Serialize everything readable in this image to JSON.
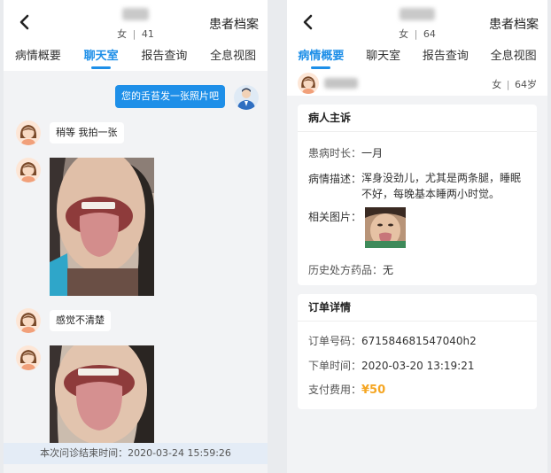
{
  "left": {
    "header": {
      "gender": "女",
      "age": "41",
      "archive_label": "患者档案"
    },
    "tabs": [
      "病情概要",
      "聊天室",
      "报告查询",
      "全息视图"
    ],
    "active_tab": 1,
    "messages": {
      "doctor_msg": "您的舌苔发一张照片吧",
      "patient_msg1": "稍等 我拍一张",
      "patient_msg2": "感觉不清楚"
    },
    "end_notice": "本次问诊结束时间：2020-03-24 15:59:26"
  },
  "right": {
    "header": {
      "gender": "女",
      "age": "64",
      "archive_label": "患者档案"
    },
    "tabs": [
      "病情概要",
      "聊天室",
      "报告查询",
      "全息视图"
    ],
    "active_tab": 0,
    "patient_row": {
      "gender": "女",
      "age": "64岁"
    },
    "complaint": {
      "title": "病人主诉",
      "duration_label": "患病时长：",
      "duration": "一月",
      "desc_label": "病情描述：",
      "desc": "浑身没劲儿，尤其是两条腿，睡眠不好，每晚基本睡两小时觉。",
      "images_label": "相关图片：",
      "history_label": "历史处方药品：",
      "history": "无"
    },
    "order": {
      "title": "订单详情",
      "no_label": "订单号码：",
      "no": "671584681547040h2",
      "time_label": "下单时间：",
      "time": "2020-03-20 13:19:21",
      "fee_label": "支付费用：",
      "fee": "¥50"
    }
  },
  "colors": {
    "accent": "#1e8fe8",
    "fee": "#f5a623",
    "bg": "#f2f3f5"
  }
}
